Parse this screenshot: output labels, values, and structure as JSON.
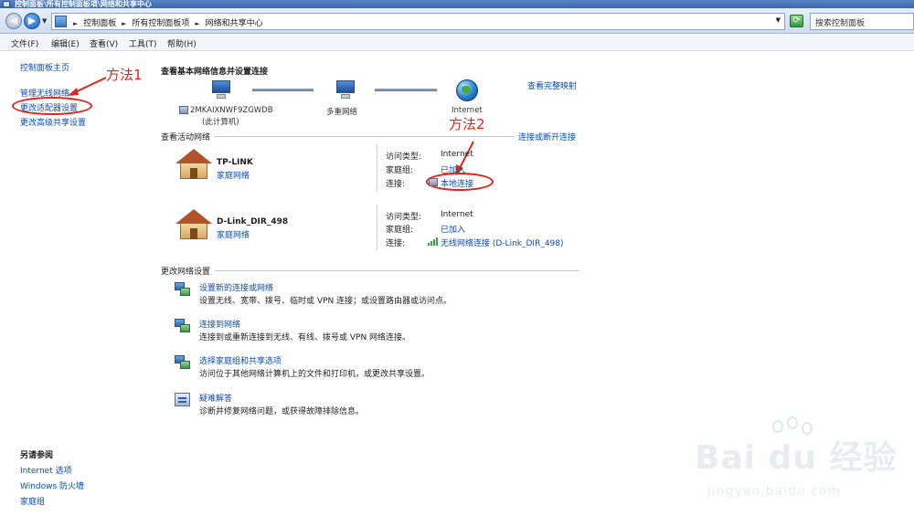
{
  "window": {
    "title": "控制面板\\所有控制面板项\\网络和共享中心"
  },
  "address": {
    "crumbs": [
      "控制面板",
      "所有控制面板项",
      "网络和共享中心"
    ],
    "search_placeholder": "搜索控制面板"
  },
  "menu": [
    "文件(F)",
    "编辑(E)",
    "查看(V)",
    "工具(T)",
    "帮助(H)"
  ],
  "sidebar": {
    "links": [
      "控制面板主页",
      "管理无线网络",
      "更改适配器设置",
      "更改高级共享设置"
    ],
    "see_also_title": "另请参阅",
    "see_also": [
      "Internet 选项",
      "Windows 防火墙",
      "家庭组"
    ]
  },
  "annotations": {
    "method1": "方法1",
    "method2": "方法2"
  },
  "main": {
    "heading": "查看基本网络信息并设置连接",
    "view_full_map": "查看完整映射",
    "map": {
      "computer_name": "2MKAIXNWF9ZGWDB",
      "computer_sub": "(此计算机)",
      "middle": "多重网络",
      "internet": "Internet"
    },
    "active_title": "查看活动网络",
    "connect_disconnect": "连接或断开连接",
    "networks": [
      {
        "name": "TP-LINK",
        "type": "家庭网络",
        "access_label": "访问类型:",
        "access_value": "Internet",
        "homegroup_label": "家庭组:",
        "homegroup_value": "已加入",
        "conn_label": "连接:",
        "conn_value": "本地连接"
      },
      {
        "name": "D-Link_DIR_498",
        "type": "家庭网络",
        "access_label": "访问类型:",
        "access_value": "Internet",
        "homegroup_label": "家庭组:",
        "homegroup_value": "已加入",
        "conn_label": "连接:",
        "conn_value": "无线网络连接 (D-Link_DIR_498)"
      }
    ],
    "change_title": "更改网络设置",
    "tasks": [
      {
        "title": "设置新的连接或网络",
        "desc": "设置无线、宽带、拨号、临时或 VPN 连接；或设置路由器或访问点。"
      },
      {
        "title": "连接到网络",
        "desc": "连接到或重新连接到无线、有线、拨号或 VPN 网络连接。"
      },
      {
        "title": "选择家庭组和共享选项",
        "desc": "访问位于其他网络计算机上的文件和打印机，或更改共享设置。"
      },
      {
        "title": "疑难解答",
        "desc": "诊断并修复网络问题，或获得故障排除信息。"
      }
    ]
  },
  "watermark": {
    "brand": "Bai du 经验",
    "url": "jingyan.baidu.com"
  },
  "colors": {
    "link": "#0a4bb3",
    "annotation": "#e2231a"
  }
}
